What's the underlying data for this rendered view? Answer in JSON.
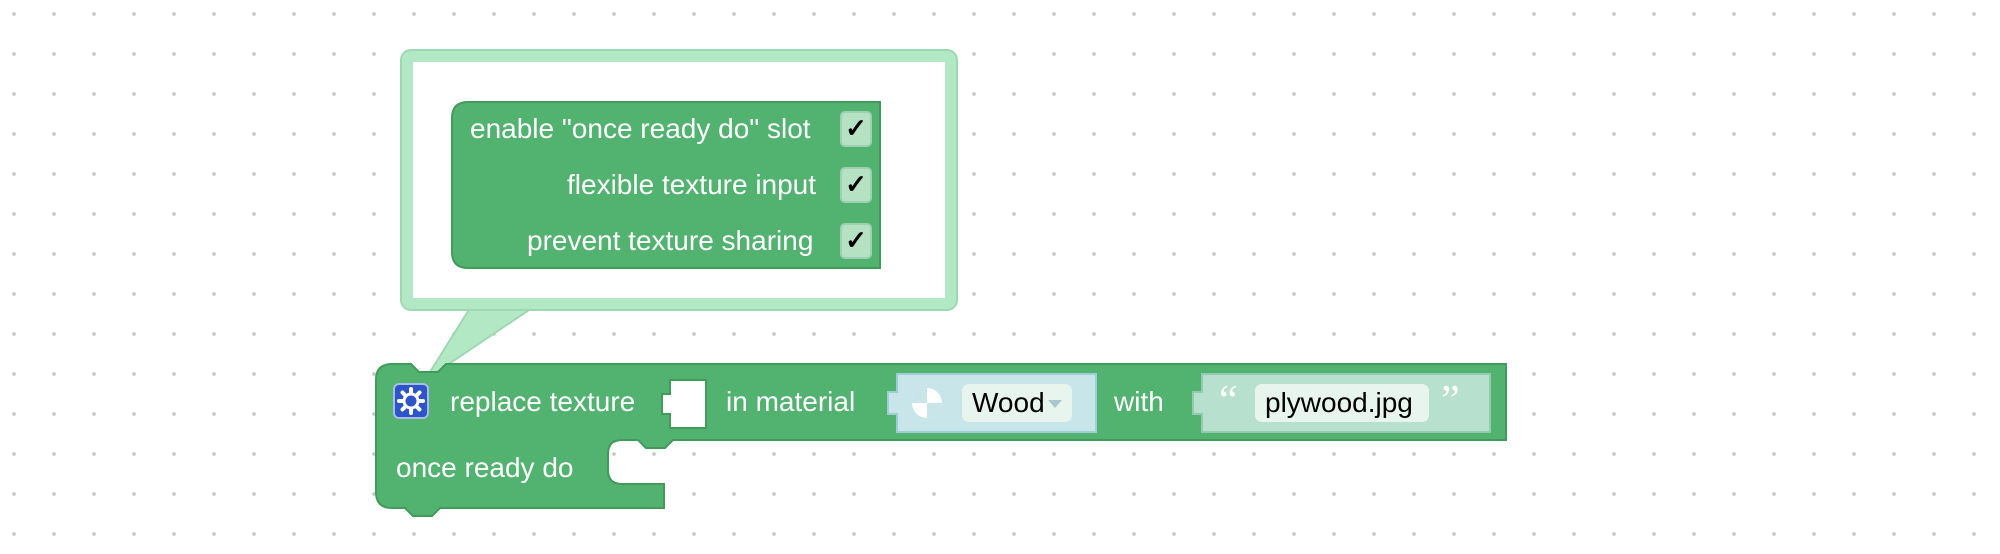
{
  "mutator": {
    "options": [
      {
        "label": "enable \"once ready do\" slot",
        "checked": true,
        "mark": "✓"
      },
      {
        "label": "flexible texture input",
        "checked": true,
        "mark": "✓"
      },
      {
        "label": "prevent texture sharing",
        "checked": true,
        "mark": "✓"
      }
    ]
  },
  "block": {
    "replace_label": "replace texture",
    "material_label": "in material",
    "material_value": "Wood",
    "with_label": "with",
    "texture_value": "plywood.jpg",
    "open_quote": "“",
    "close_quote": "”",
    "once_ready_label": "once ready do"
  },
  "colors": {
    "block_green": "#52b270",
    "block_border": "#429a5c",
    "bubble_border": "#b3e8c4",
    "material_input_bg": "#c8e5ea",
    "text_input_bg": "#b8e0ce",
    "gear_blue": "#2d54c8"
  },
  "icons": {
    "gear": "gear-icon",
    "material": "material-icon",
    "dropdown": "chevron-down-icon",
    "check": "checkmark-icon"
  }
}
